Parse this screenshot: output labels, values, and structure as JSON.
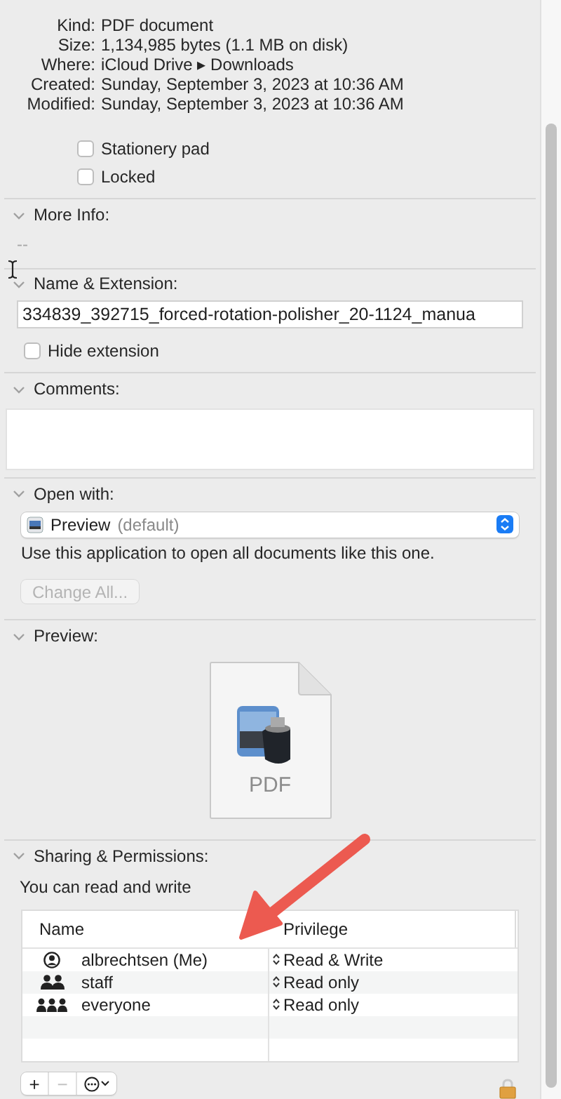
{
  "general": {
    "rows": [
      {
        "label": "Kind:",
        "value": "PDF document"
      },
      {
        "label": "Size:",
        "value": "1,134,985 bytes (1.1 MB on disk)"
      },
      {
        "label": "Where:",
        "value": "iCloud Drive ▸ Downloads"
      },
      {
        "label": "Created:",
        "value": "Sunday, September 3, 2023 at 10:36 AM"
      },
      {
        "label": "Modified:",
        "value": "Sunday, September 3, 2023 at 10:36 AM"
      }
    ],
    "options": [
      {
        "label": "Stationery pad",
        "checked": false
      },
      {
        "label": "Locked",
        "checked": false
      }
    ]
  },
  "more_info": {
    "title": "More Info:",
    "expanded": true,
    "value": "--"
  },
  "name_extension": {
    "title": "Name & Extension:",
    "expanded": true,
    "value": "334839_392715_forced-rotation-polisher_20-1124_manua",
    "hide_extension": {
      "label": "Hide extension",
      "checked": false
    }
  },
  "comments": {
    "title": "Comments:",
    "expanded": true
  },
  "open_with": {
    "title": "Open with:",
    "expanded": true,
    "app": "Preview",
    "app_note": "(default)",
    "hint": "Use this application to open all documents like this one.",
    "button": {
      "label": "Change All...",
      "disabled": true
    }
  },
  "preview": {
    "title": "Preview:",
    "expanded": true,
    "label": "PDF"
  },
  "sharing": {
    "title": "Sharing & Permissions:",
    "expanded": true,
    "summary": "You can read and write",
    "columns": [
      "Name",
      "Privilege"
    ],
    "rows": [
      {
        "kind": "user",
        "name": "albrechtsen (Me)",
        "privilege": "Read & Write"
      },
      {
        "kind": "group",
        "name": "staff",
        "privilege": "Read only"
      },
      {
        "kind": "everyone",
        "name": "everyone",
        "privilege": "Read only"
      }
    ],
    "tools": [
      {
        "label": "+",
        "disabled": false
      },
      {
        "label": "−",
        "disabled": true
      }
    ]
  }
}
